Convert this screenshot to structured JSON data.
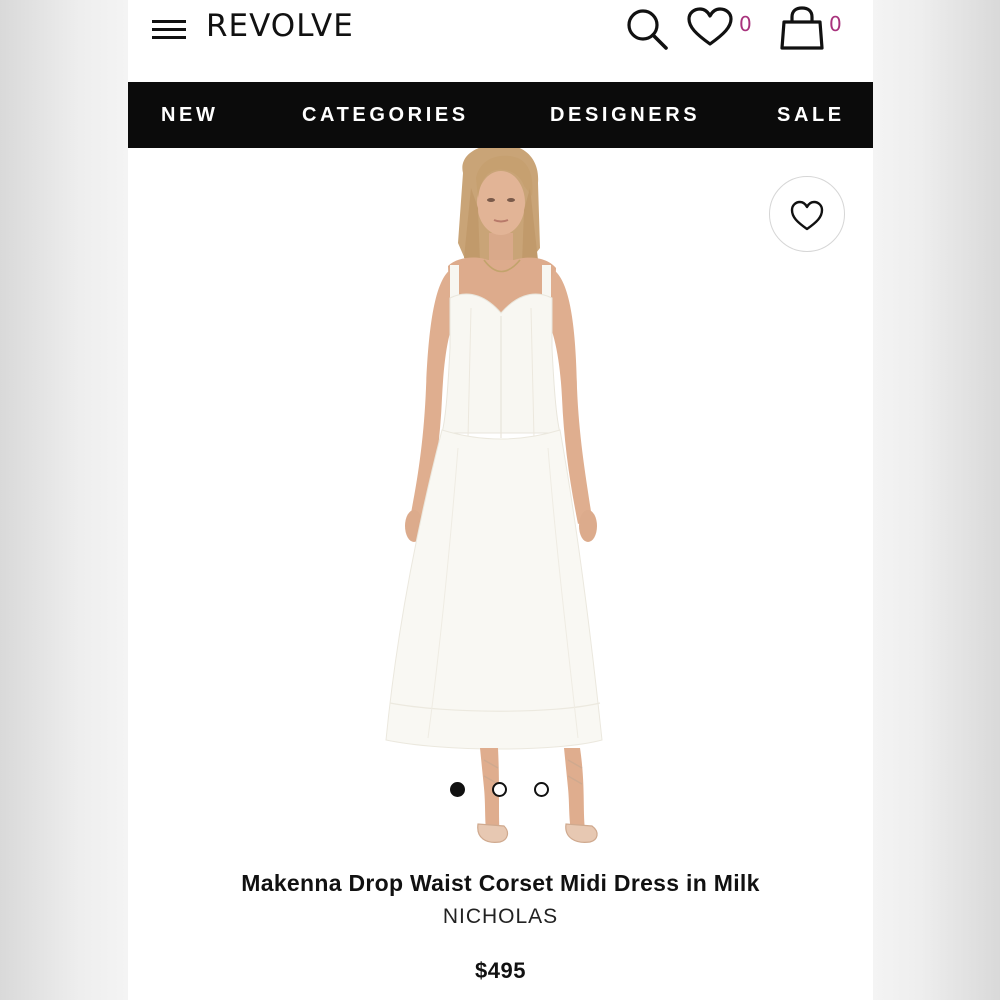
{
  "header": {
    "logo": "REVOLVE",
    "wishlist_count": "0",
    "bag_count": "0",
    "icons": [
      "hamburger-menu-icon",
      "search-icon",
      "heart-icon",
      "shopping-bag-icon"
    ],
    "count_color": "#a8327c"
  },
  "nav": {
    "items": [
      {
        "label": "NEW"
      },
      {
        "label": "CATEGORIES"
      },
      {
        "label": "DESIGNERS"
      },
      {
        "label": "SALE"
      }
    ],
    "background": "#0b0b0b"
  },
  "product": {
    "image_icon": "product-photo-white-midi-dress",
    "wishlist_icon": "heart-icon",
    "carousel": {
      "total": 3,
      "active": 1
    },
    "title": "Makenna Drop Waist Corset Midi Dress in Milk",
    "designer": "NICHOLAS",
    "price": "$495"
  }
}
